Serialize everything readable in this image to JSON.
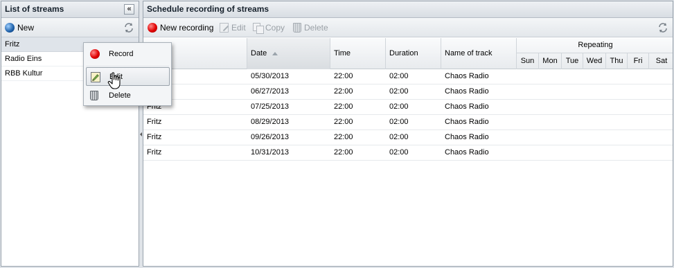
{
  "left_panel": {
    "title": "List of streams",
    "collapse_glyph": "«",
    "toolbar": {
      "new_label": "New",
      "new_icon": "globe-icon",
      "refresh_icon": "refresh-icon"
    },
    "streams": [
      {
        "name": "Fritz",
        "selected": true
      },
      {
        "name": "Radio Eins",
        "selected": false
      },
      {
        "name": "RBB Kultur",
        "selected": false
      }
    ]
  },
  "context_menu": {
    "items": [
      {
        "label": "Record",
        "icon": "record-icon"
      },
      {
        "label": "Edit",
        "icon": "edit-icon",
        "hover": true
      },
      {
        "label": "Delete",
        "icon": "trash-icon"
      }
    ]
  },
  "right_panel": {
    "title": "Schedule recording of streams",
    "toolbar": {
      "new_recording_label": "New recording",
      "edit_label": "Edit",
      "copy_label": "Copy",
      "delete_label": "Delete"
    },
    "grid": {
      "columns": {
        "stream": "",
        "date": "Date",
        "time": "Time",
        "duration": "Duration",
        "track": "Name of track",
        "repeating": "Repeating"
      },
      "days": [
        "Sun",
        "Mon",
        "Tue",
        "Wed",
        "Thu",
        "Fri",
        "Sat"
      ],
      "sorted_column": "Date",
      "sort_direction": "ascending",
      "rows": [
        {
          "stream": "",
          "date": "05/30/2013",
          "time": "22:00",
          "duration": "02:00",
          "track": "Chaos Radio"
        },
        {
          "stream": "",
          "date": "06/27/2013",
          "time": "22:00",
          "duration": "02:00",
          "track": "Chaos Radio"
        },
        {
          "stream": "Fritz",
          "date": "07/25/2013",
          "time": "22:00",
          "duration": "02:00",
          "track": "Chaos Radio"
        },
        {
          "stream": "Fritz",
          "date": "08/29/2013",
          "time": "22:00",
          "duration": "02:00",
          "track": "Chaos Radio"
        },
        {
          "stream": "Fritz",
          "date": "09/26/2013",
          "time": "22:00",
          "duration": "02:00",
          "track": "Chaos Radio"
        },
        {
          "stream": "Fritz",
          "date": "10/31/2013",
          "time": "22:00",
          "duration": "02:00",
          "track": "Chaos Radio"
        }
      ]
    }
  },
  "colors": {
    "record_red": "#e00000",
    "panel_border": "#99a3ad",
    "disabled_text": "#9aa0a6",
    "selection": "#dfe4ea"
  }
}
